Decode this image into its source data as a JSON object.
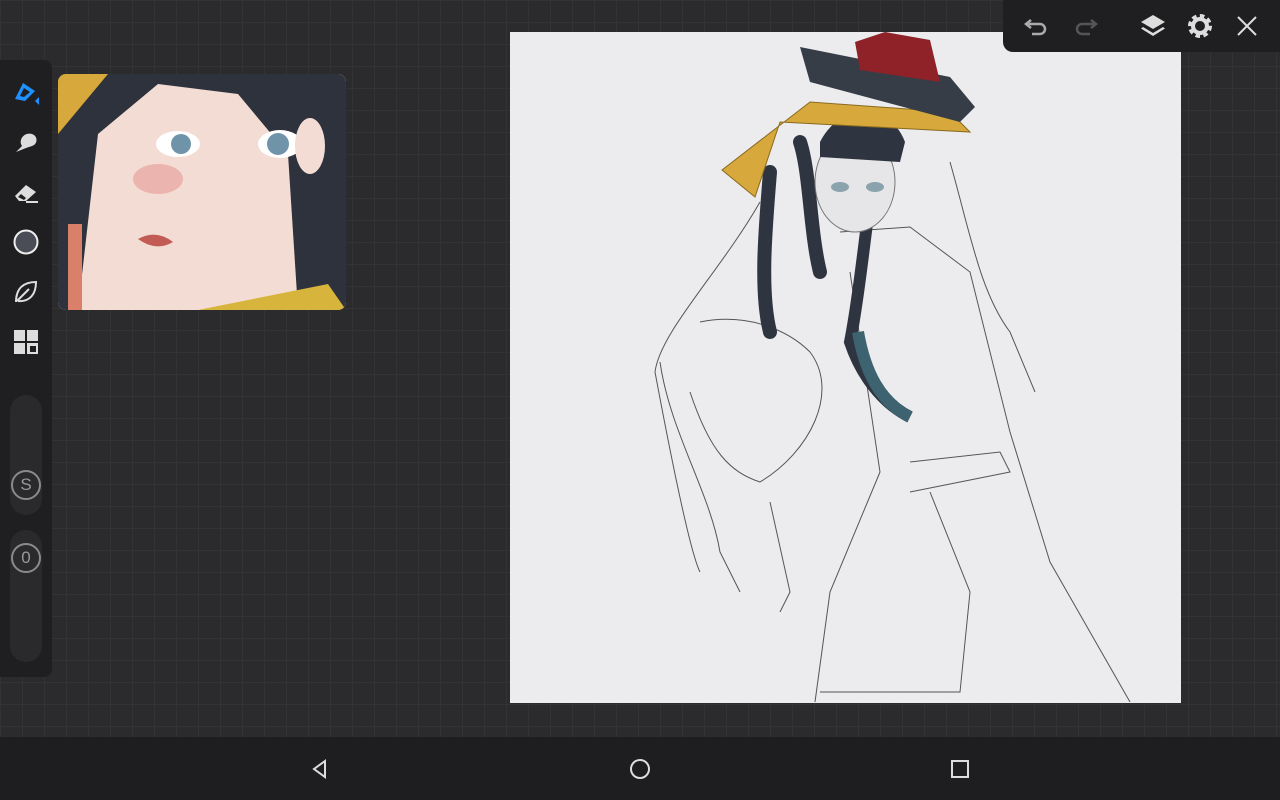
{
  "toolbar": {
    "tools": [
      "brush",
      "smudge",
      "eraser",
      "color",
      "shape",
      "panels"
    ],
    "size_label": "S",
    "opacity_label": "0",
    "accent": "#1e90ff"
  },
  "topbar": {
    "icons": [
      "undo",
      "redo",
      "layers",
      "settings",
      "close"
    ]
  },
  "navbar": {
    "icons": [
      "back",
      "home",
      "recents"
    ]
  }
}
